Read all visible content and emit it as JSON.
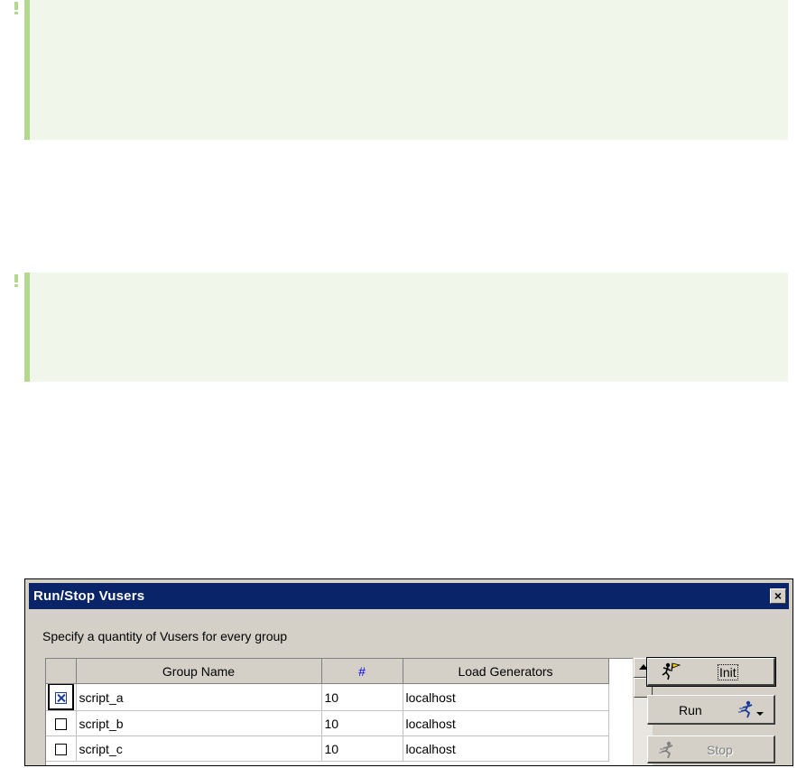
{
  "dialog": {
    "title": "Run/Stop Vusers",
    "close_label": "×",
    "instruction": "Specify a quantity of Vusers for every group",
    "table": {
      "columns": [
        "",
        "Group Name",
        "#",
        "Load Generators"
      ],
      "rows": [
        {
          "checked": true,
          "group": "script_a",
          "count": "10",
          "generator": "localhost"
        },
        {
          "checked": false,
          "group": "script_b",
          "count": "10",
          "generator": "localhost"
        },
        {
          "checked": false,
          "group": "script_c",
          "count": "10",
          "generator": "localhost"
        }
      ]
    },
    "buttons": {
      "init": "Init",
      "run": "Run",
      "stop": "Stop"
    }
  },
  "colors": {
    "titlebar": "#0a246a",
    "note_bg": "#f1f6ea",
    "note_accent": "#b3d98f",
    "dialog_bg": "#d4d0c8"
  }
}
